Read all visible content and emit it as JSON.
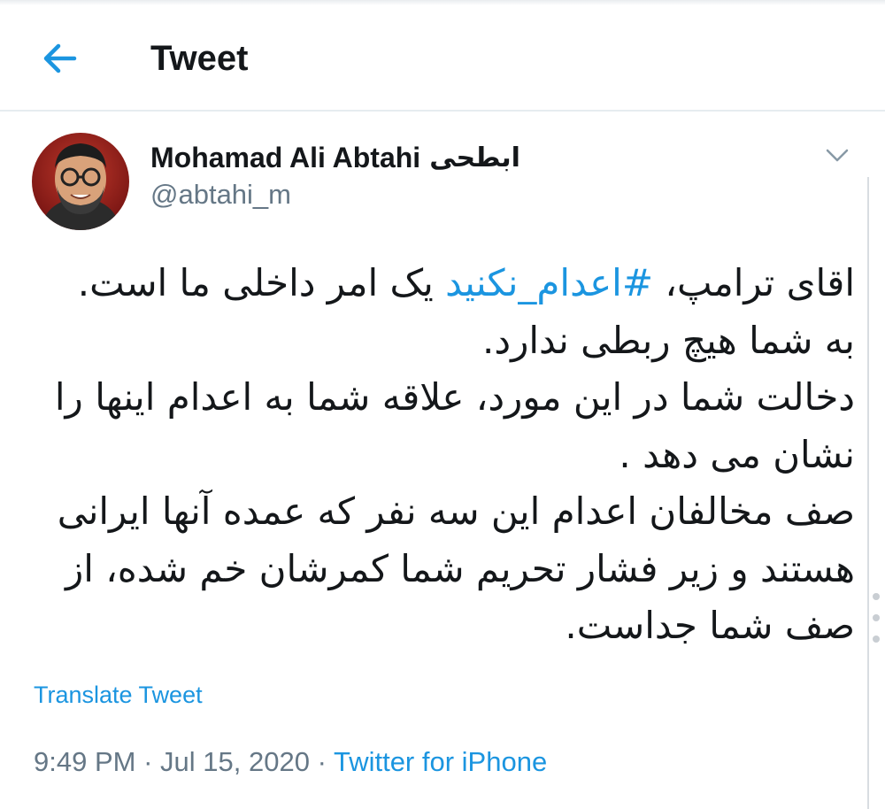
{
  "header": {
    "title": "Tweet",
    "back_icon": "arrow-left-icon"
  },
  "colors": {
    "accent": "#1b95e0",
    "text": "#14171a",
    "secondary": "#657786",
    "divider": "#e6ecf0"
  },
  "author": {
    "display_name": "Mohamad Ali Abtahi",
    "display_name_fa": "ابطحی",
    "handle": "@abtahi_m",
    "avatar_icon": "profile-photo",
    "menu_icon": "chevron-down-icon"
  },
  "tweet": {
    "line1_before": "اقای ترامپ، ",
    "hashtag": "#اعدام_نکنید",
    "line1_after": " یک امر داخلی ما است.",
    "line2": "به شما هیچ ربطی ندارد.",
    "line3": "دخالت شما در این مورد، علاقه شما به اعدام اینها را",
    "line4": "نشان می دهد .",
    "line5": "صف مخالفان اعدام این سه نفر که عمده آنها ایرانی",
    "line6": "هستند و زیر فشار تحریم شما کمرشان خم شده، از",
    "line7": "صف شما جداست."
  },
  "translate_label": "Translate Tweet",
  "meta": {
    "time": "9:49 PM",
    "separator": "·",
    "date": "Jul 15, 2020",
    "source": "Twitter for iPhone"
  }
}
